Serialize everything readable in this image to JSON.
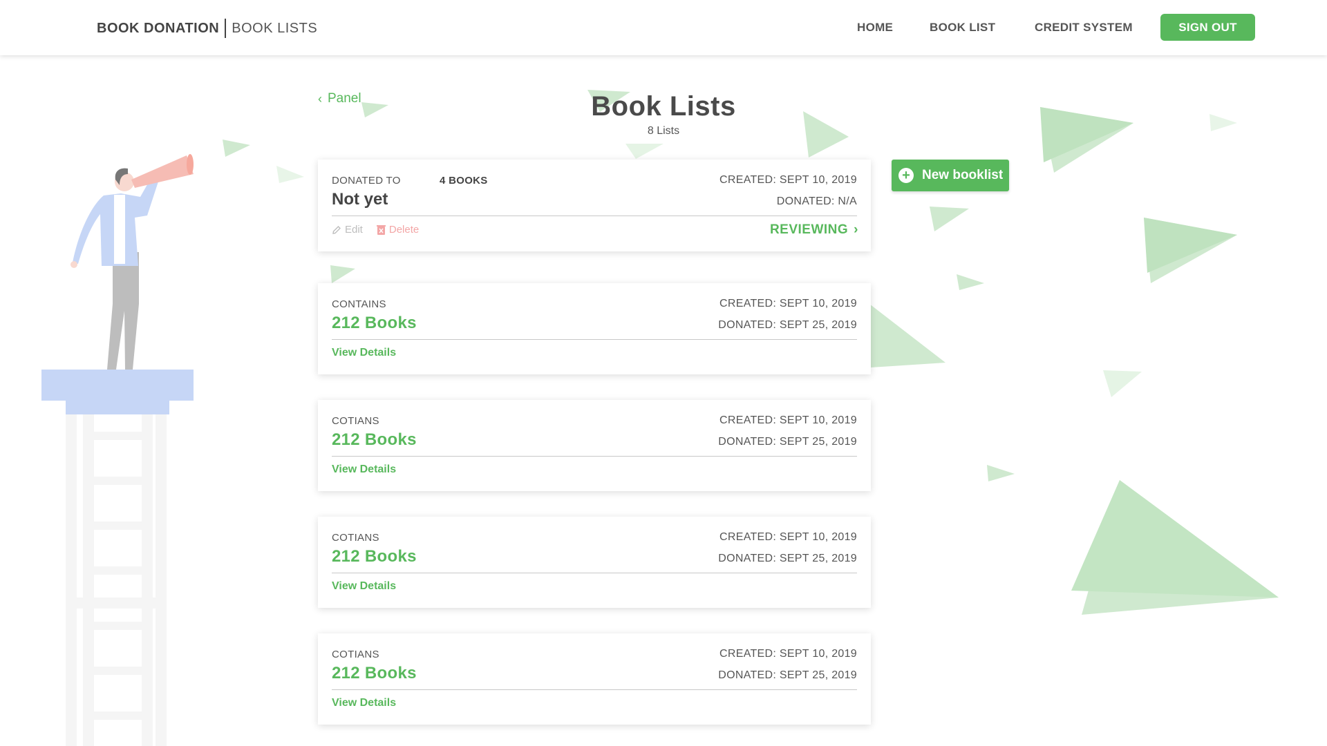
{
  "header": {
    "brand_main": "BOOK DONATION",
    "brand_sub": "BOOK LISTS",
    "nav": [
      "HOME",
      "BOOK LIST",
      "CREDIT SYSTEM"
    ],
    "signout_label": "SIGN OUT"
  },
  "back_label": "Panel",
  "title": "Book Lists",
  "subtitle": "8 Lists",
  "new_button_label": "New booklist",
  "colors": {
    "accent": "#58b85c",
    "delete": "#f3a6a6"
  },
  "cards": [
    {
      "label": "DONATED TO",
      "value": "Not yet",
      "count": "4 BOOKS",
      "created": "CREATED: SEPT 10, 2019",
      "donated": "DONATED: N/A",
      "edit": "Edit",
      "delete": "Delete",
      "status": "REVIEWING"
    },
    {
      "label": "CONTAINS",
      "value": "212 Books",
      "created": "CREATED: SEPT 10, 2019",
      "donated": "DONATED: SEPT 25, 2019",
      "link": "View Details"
    },
    {
      "label": "COTIANS",
      "value": "212 Books",
      "created": "CREATED: SEPT 10, 2019",
      "donated": "DONATED: SEPT 25, 2019",
      "link": "View Details"
    },
    {
      "label": "COTIANS",
      "value": "212 Books",
      "created": "CREATED: SEPT 10, 2019",
      "donated": "DONATED: SEPT 25, 2019",
      "link": "View Details"
    },
    {
      "label": "COTIANS",
      "value": "212 Books",
      "created": "CREATED: SEPT 10, 2019",
      "donated": "DONATED: SEPT 25, 2019",
      "link": "View Details"
    }
  ]
}
